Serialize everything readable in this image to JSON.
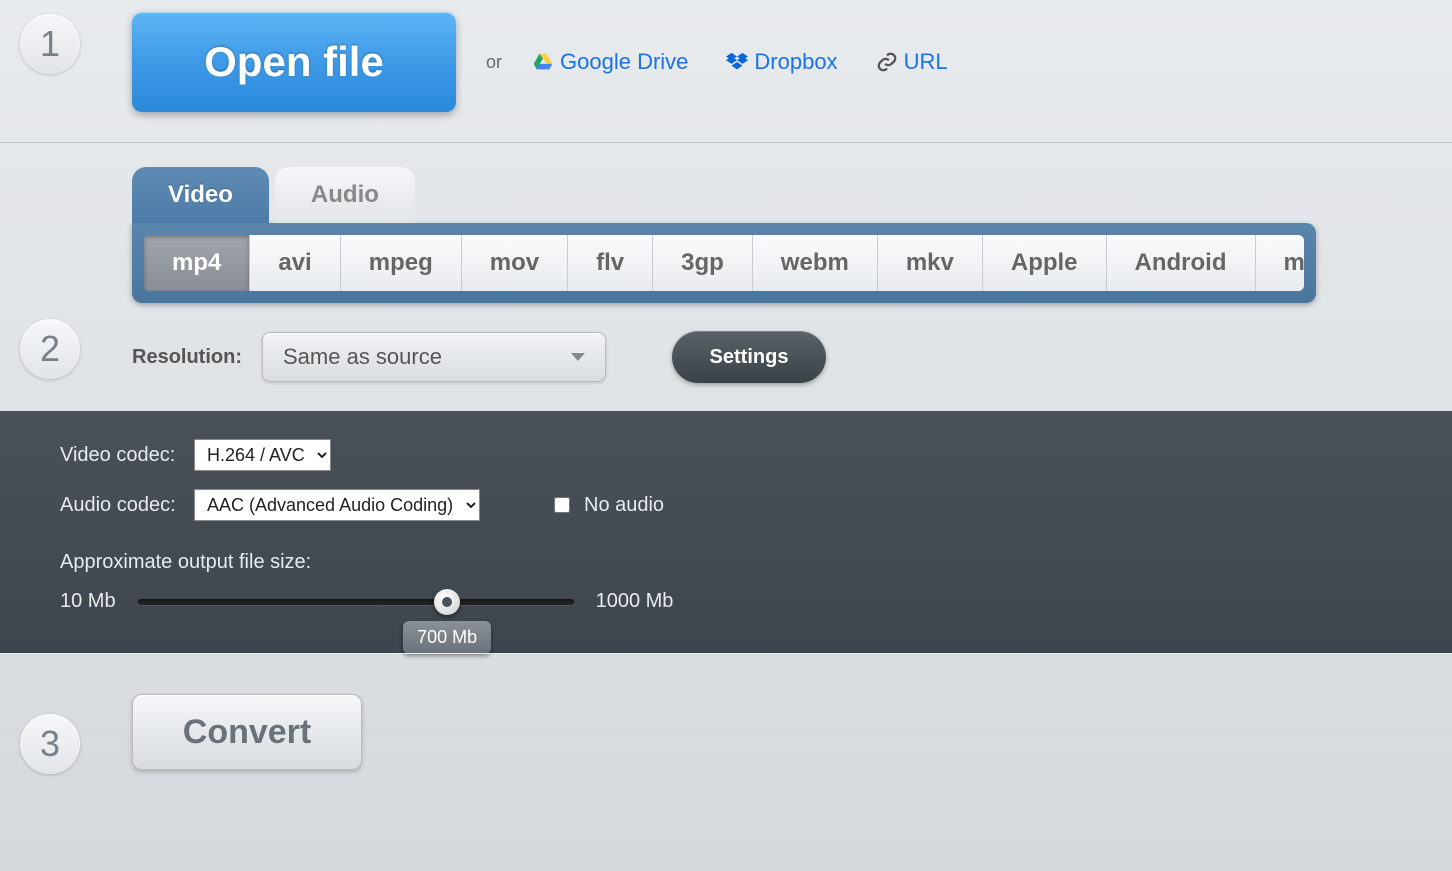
{
  "steps": {
    "one": "1",
    "two": "2",
    "three": "3"
  },
  "open": {
    "button": "Open file",
    "or": "or",
    "gdrive": "Google Drive",
    "dropbox": "Dropbox",
    "url": "URL"
  },
  "tabs": {
    "video": "Video",
    "audio": "Audio"
  },
  "formats": {
    "mp4": "mp4",
    "avi": "avi",
    "mpeg": "mpeg",
    "mov": "mov",
    "flv": "flv",
    "3gp": "3gp",
    "webm": "webm",
    "mkv": "mkv",
    "apple": "Apple",
    "android": "Android",
    "more": "more"
  },
  "resolution": {
    "label": "Resolution:",
    "value": "Same as source"
  },
  "settings_btn": "Settings",
  "codec": {
    "video_label": "Video codec:",
    "video_value": "H.264 / AVC",
    "audio_label": "Audio codec:",
    "audio_value": "AAC (Advanced Audio Coding)",
    "no_audio": "No audio"
  },
  "size": {
    "label": "Approximate output file size:",
    "min": "10 Mb",
    "max": "1000 Mb",
    "value": "700 Mb",
    "percent": 71
  },
  "convert": "Convert"
}
